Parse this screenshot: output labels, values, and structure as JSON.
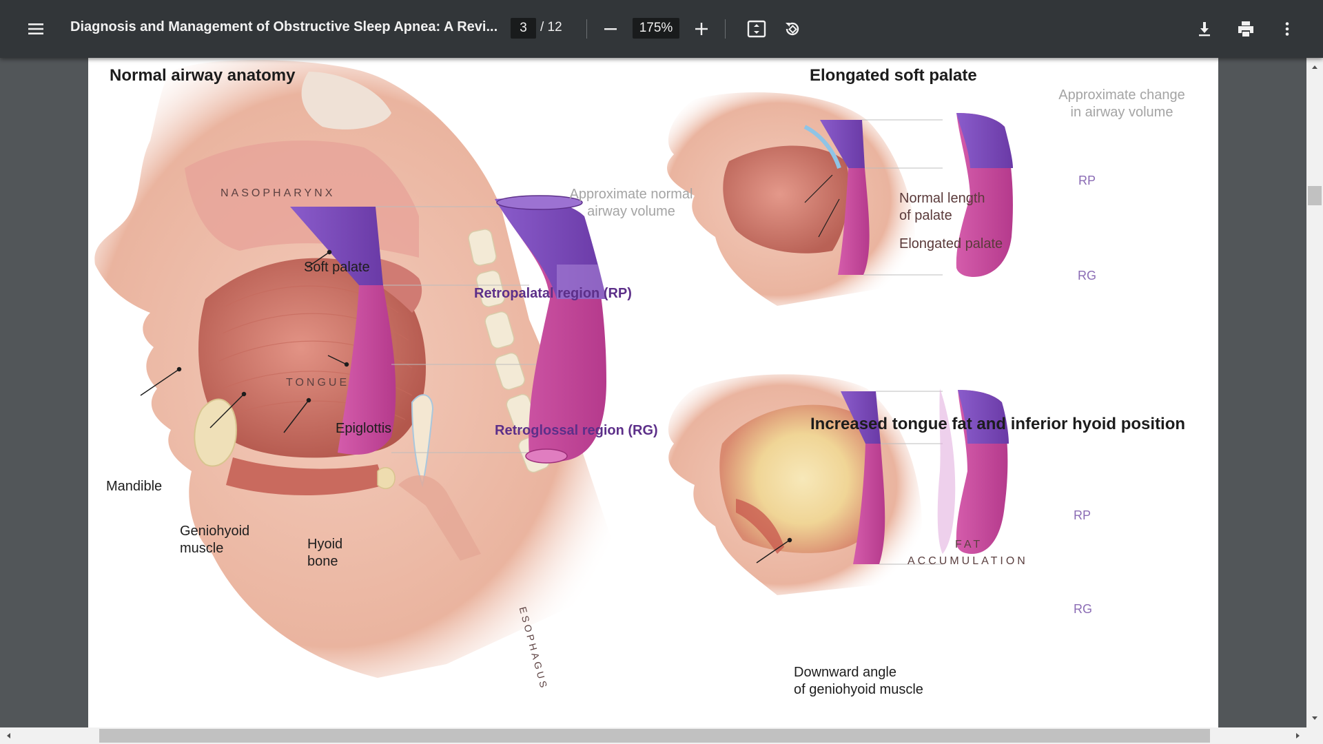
{
  "toolbar": {
    "title": "Diagnosis and Management of Obstructive Sleep Apnea: A Revi...",
    "page_current": "3",
    "page_total": "/ 12",
    "zoom": "175%"
  },
  "figure": {
    "normal": {
      "heading": "Normal airway anatomy",
      "nasopharynx": "NASOPHARYNX",
      "soft_palate": "Soft palate",
      "tongue": "TONGUE",
      "epiglottis": "Epiglottis",
      "mandible": "Mandible",
      "geniohyoid_1": "Geniohyoid",
      "geniohyoid_2": "muscle",
      "hyoid_1": "Hyoid",
      "hyoid_2": "bone",
      "esophagus": "ESOPHAGUS",
      "volume_1": "Approximate normal",
      "volume_2": "airway volume",
      "rp_region": "Retropalatal region (RP)",
      "rg_region": "Retroglossal region (RG)"
    },
    "elongated": {
      "heading": "Elongated soft palate",
      "change_1": "Approximate change",
      "change_2": "in airway volume",
      "normal_len_1": "Normal length",
      "normal_len_2": "of palate",
      "elongated_palate": "Elongated palate",
      "rp": "RP",
      "rg": "RG"
    },
    "tongue_fat": {
      "heading": "Increased tongue fat and inferior hyoid position",
      "fat": "FAT",
      "accumulation": "ACCUMULATION",
      "rp": "RP",
      "rg": "RG",
      "downward_1": "Downward angle",
      "downward_2": "of geniohyoid muscle"
    }
  },
  "colors": {
    "toolbar_bg": "#323639",
    "viewer_bg": "#525659",
    "airway_purple": "#7b4bb8",
    "airway_magenta": "#c8479e",
    "label_purple": "#5c2f89"
  }
}
